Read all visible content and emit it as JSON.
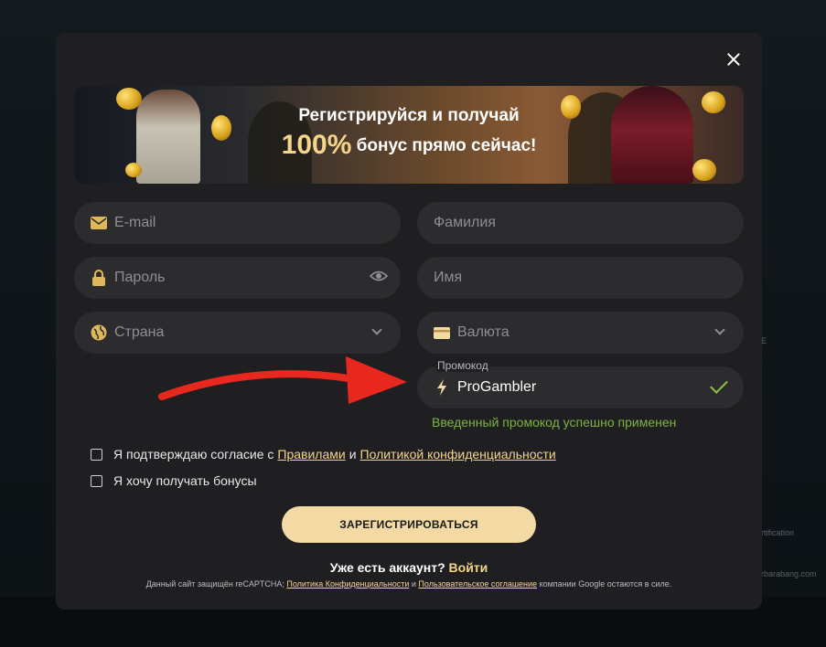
{
  "banner": {
    "line1": "Регистрируйся и получай",
    "percent": "100%",
    "line2": "бонус прямо сейчас!"
  },
  "fields": {
    "email": {
      "placeholder": "E-mail",
      "icon": "envelope-icon"
    },
    "lastname": {
      "placeholder": "Фамилия"
    },
    "password": {
      "placeholder": "Пароль",
      "icon": "lock-icon",
      "trailing_icon": "eye-icon"
    },
    "firstname": {
      "placeholder": "Имя"
    },
    "country": {
      "placeholder": "Страна",
      "icon": "globe-icon"
    },
    "currency": {
      "placeholder": "Валюта",
      "icon": "card-icon"
    }
  },
  "promo": {
    "label": "Промокод",
    "value": "ProGambler",
    "icon": "lightning-icon",
    "success": "Введенный промокод успешно применен"
  },
  "consent": {
    "prefix": "Я подтверждаю согласие с",
    "rules_link": "Правилами",
    "and": "и",
    "privacy_link": "Политикой конфиденциальности"
  },
  "bonus": {
    "label": "Я хочу получать бонусы"
  },
  "register_button": "ЗАРЕГИСТРИРОВАТЬСЯ",
  "have_account": {
    "text": "Уже есть аккаунт?",
    "login": "Войти"
  },
  "recaptcha": {
    "prefix": "Данный сайт защищён reCAPTCHA;",
    "privacy": "Политика Конфиденциальности",
    "and": "и",
    "terms": "Пользовательское соглашение",
    "suffix": "компании Google остаются в силе."
  },
  "background": {
    "side_text_1": "E",
    "side_text_2": "rtification",
    "side_text_3": "rbarabang.com"
  },
  "colors": {
    "accent": "#f5d58a",
    "button": "#f3d9a4",
    "success": "#7cb342",
    "arrow": "#e8281e"
  }
}
